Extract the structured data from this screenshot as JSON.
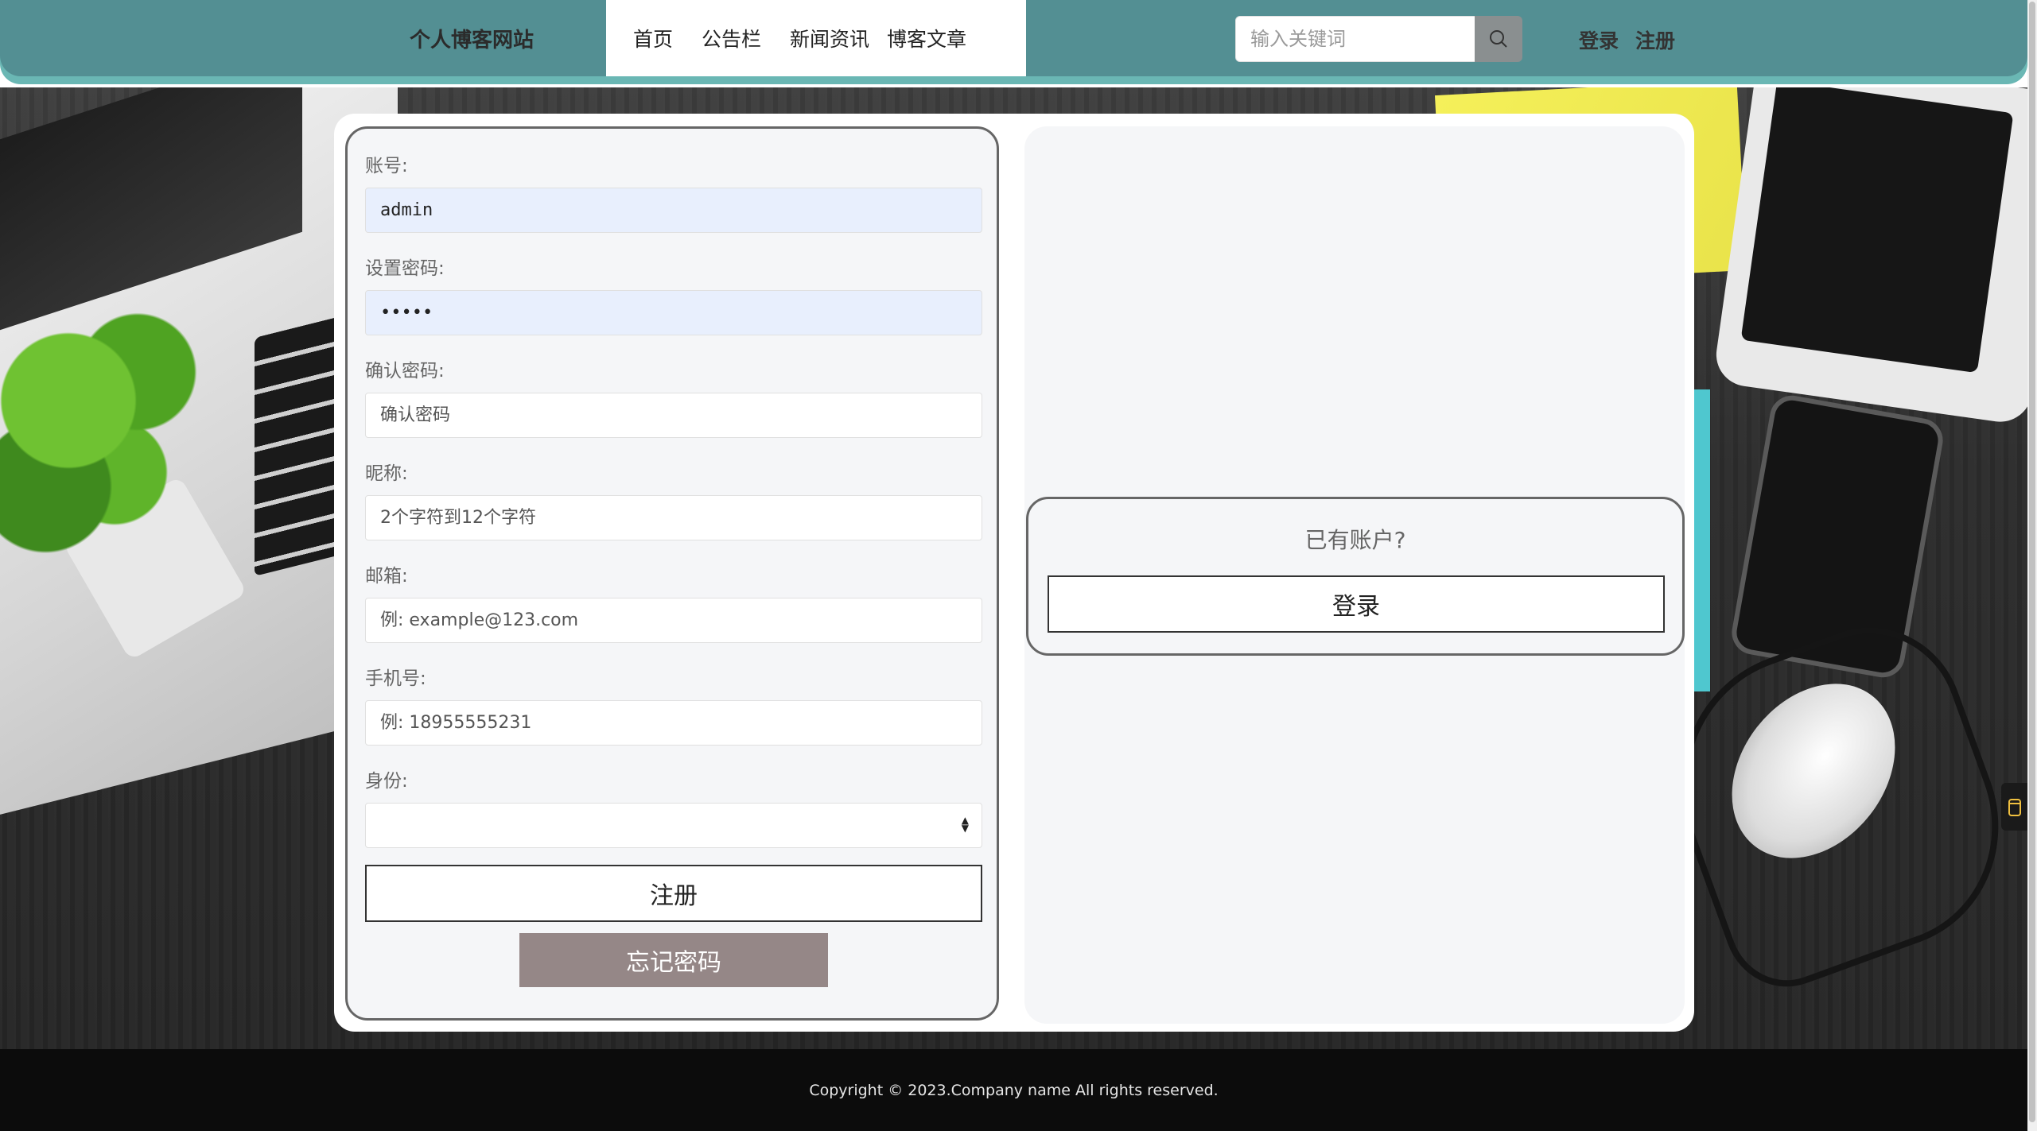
{
  "header": {
    "site_title": "个人博客网站",
    "nav": [
      {
        "label": "首页"
      },
      {
        "label": "公告栏"
      },
      {
        "label": "新闻资讯"
      },
      {
        "label": "博客文章"
      }
    ],
    "search": {
      "placeholder": "输入关键词",
      "icon": "search-icon"
    },
    "login_label": "登录",
    "register_label": "注册"
  },
  "form": {
    "account": {
      "label": "账号:",
      "value": "admin"
    },
    "password": {
      "label": "设置密码:",
      "value": "•••••"
    },
    "confirm_password": {
      "label": "确认密码:",
      "placeholder": "确认密码"
    },
    "nickname": {
      "label": "昵称:",
      "placeholder": "2个字符到12个字符"
    },
    "email": {
      "label": "邮箱:",
      "placeholder": "例: example@123.com"
    },
    "phone": {
      "label": "手机号:",
      "placeholder": "例: 18955555231"
    },
    "role": {
      "label": "身份:",
      "value": ""
    },
    "register_button": "注册",
    "forgot_button": "忘记密码"
  },
  "login_panel": {
    "question": "已有账户?",
    "login_button": "登录"
  },
  "footer": {
    "copyright": "Copyright © 2023.Company name All rights reserved."
  },
  "colors": {
    "header": "#538f93",
    "header_shadow": "#6ab7b4",
    "forgot_button": "#958787",
    "search_button": "#8a8f90",
    "footer": "#0c0c0c"
  }
}
